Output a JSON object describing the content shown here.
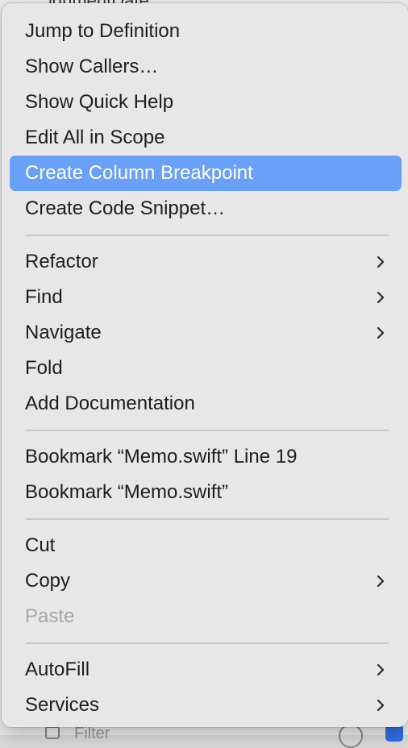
{
  "menu": {
    "items": [
      {
        "label": "Jump to Definition",
        "submenu": false,
        "highlight": false,
        "disabled": false
      },
      {
        "label": "Show Callers…",
        "submenu": false,
        "highlight": false,
        "disabled": false
      },
      {
        "label": "Show Quick Help",
        "submenu": false,
        "highlight": false,
        "disabled": false
      },
      {
        "label": "Edit All in Scope",
        "submenu": false,
        "highlight": false,
        "disabled": false
      },
      {
        "label": "Create Column Breakpoint",
        "submenu": false,
        "highlight": true,
        "disabled": false
      },
      {
        "label": "Create Code Snippet…",
        "submenu": false,
        "highlight": false,
        "disabled": false
      },
      {
        "label": "Refactor",
        "submenu": true,
        "highlight": false,
        "disabled": false
      },
      {
        "label": "Find",
        "submenu": true,
        "highlight": false,
        "disabled": false
      },
      {
        "label": "Navigate",
        "submenu": true,
        "highlight": false,
        "disabled": false
      },
      {
        "label": "Fold",
        "submenu": false,
        "highlight": false,
        "disabled": false
      },
      {
        "label": "Add Documentation",
        "submenu": false,
        "highlight": false,
        "disabled": false
      },
      {
        "label": "Bookmark “Memo.swift” Line 19",
        "submenu": false,
        "highlight": false,
        "disabled": false
      },
      {
        "label": "Bookmark “Memo.swift”",
        "submenu": false,
        "highlight": false,
        "disabled": false
      },
      {
        "label": "Cut",
        "submenu": false,
        "highlight": false,
        "disabled": false
      },
      {
        "label": "Copy",
        "submenu": true,
        "highlight": false,
        "disabled": false
      },
      {
        "label": "Paste",
        "submenu": false,
        "highlight": false,
        "disabled": true
      },
      {
        "label": "AutoFill",
        "submenu": true,
        "highlight": false,
        "disabled": false
      },
      {
        "label": "Services",
        "submenu": true,
        "highlight": false,
        "disabled": false
      }
    ]
  },
  "background": {
    "filter_placeholder": "Filter",
    "title_fragment": "ignmentDate"
  },
  "colors": {
    "highlight": "#6aa0f7",
    "menu_bg": "#e7e7e7",
    "disabled_text": "#a8a8a8"
  }
}
